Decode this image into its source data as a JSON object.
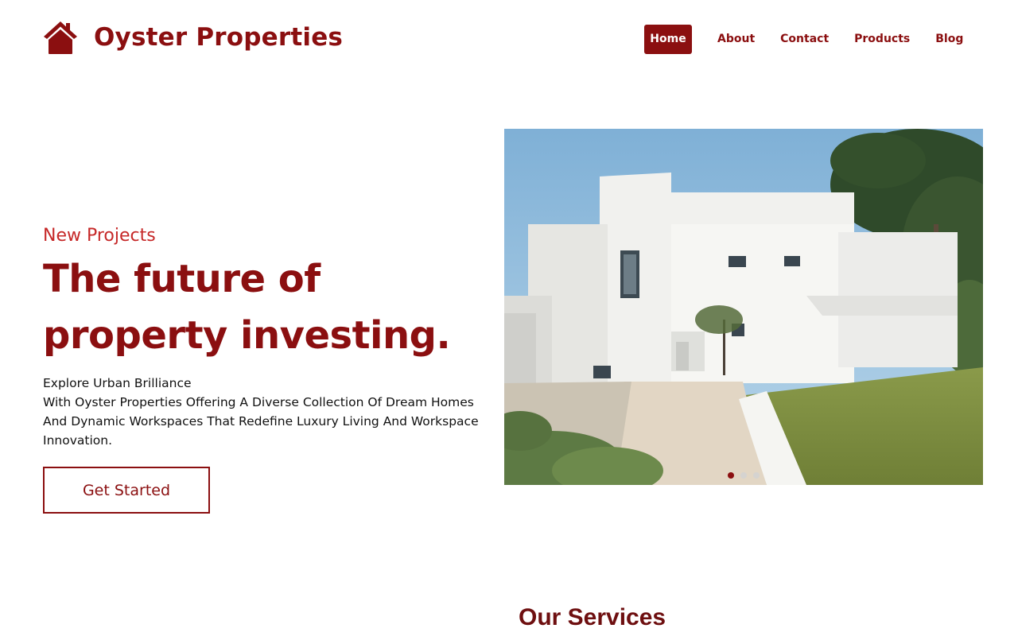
{
  "brand": {
    "name": "Oyster Properties",
    "icon": "house-icon",
    "color": "#8b0f10"
  },
  "nav": {
    "items": [
      {
        "label": "Home",
        "active": true
      },
      {
        "label": "About",
        "active": false
      },
      {
        "label": "Contact",
        "active": false
      },
      {
        "label": "Products",
        "active": false
      },
      {
        "label": "Blog",
        "active": false
      }
    ]
  },
  "hero": {
    "eyebrow": "New Projects",
    "title": "The future of property investing.",
    "subtitle": "Explore Urban Brilliance",
    "description": "With Oyster Properties Offering A Diverse Collection Of Dream Homes And Dynamic Workspaces That Redefine Luxury Living And Workspace Innovation.",
    "cta_label": "Get Started",
    "carousel": {
      "slide_count": 3,
      "active_index": 0
    }
  },
  "services": {
    "title": "Our Services"
  },
  "colors": {
    "accent": "#8b0f10",
    "eyebrow": "#c62828",
    "services_title": "#6e0f10"
  }
}
